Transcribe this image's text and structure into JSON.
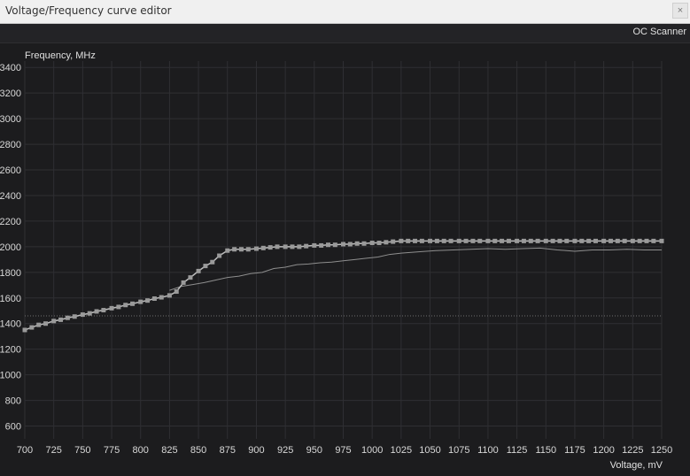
{
  "window": {
    "title": "Voltage/Frequency curve editor",
    "close_label": "×"
  },
  "toolbar": {
    "oc_scanner_label": "OC Scanner"
  },
  "colors": {
    "background": "#1c1c1e",
    "grid": "#2f2f33",
    "curve": "#bdbdbd",
    "point": "#9a9a9a",
    "reference_line": "#6e6e6e",
    "ref_curve": "#8e8e8e"
  },
  "chart_data": {
    "type": "line",
    "xlabel": "Voltage, mV",
    "ylabel": "Frequency, MHz",
    "xlim": [
      700,
      1250
    ],
    "ylim": [
      500,
      3450
    ],
    "x_ticks": [
      700,
      725,
      750,
      775,
      800,
      825,
      850,
      875,
      900,
      925,
      950,
      975,
      1000,
      1025,
      1050,
      1075,
      1100,
      1125,
      1150,
      1175,
      1200,
      1225,
      1250
    ],
    "y_ticks": [
      600,
      800,
      1000,
      1200,
      1400,
      1600,
      1800,
      2000,
      2200,
      2400,
      2600,
      2800,
      3000,
      3200,
      3400
    ],
    "grid": true,
    "reference_line_y": 1460,
    "series": [
      {
        "role": "editable curve",
        "x": [
          700,
          706,
          712,
          718,
          725,
          731,
          737,
          743,
          750,
          756,
          762,
          768,
          775,
          781,
          787,
          793,
          800,
          806,
          812,
          818,
          825,
          831,
          837,
          843,
          850,
          856,
          862,
          868,
          875,
          881,
          887,
          893,
          900,
          906,
          912,
          918,
          925,
          931,
          937,
          943,
          950,
          956,
          962,
          968,
          975,
          981,
          987,
          993,
          1000,
          1006,
          1012,
          1018,
          1025,
          1031,
          1037,
          1043,
          1050,
          1056,
          1062,
          1068,
          1075,
          1081,
          1087,
          1093,
          1100,
          1106,
          1112,
          1118,
          1125,
          1131,
          1137,
          1143,
          1150,
          1156,
          1162,
          1168,
          1175,
          1181,
          1187,
          1193,
          1200,
          1206,
          1212,
          1218,
          1225,
          1231,
          1237,
          1243,
          1250
        ],
        "y": [
          1350,
          1370,
          1390,
          1400,
          1420,
          1430,
          1445,
          1455,
          1470,
          1480,
          1495,
          1505,
          1520,
          1530,
          1545,
          1555,
          1570,
          1580,
          1595,
          1605,
          1620,
          1650,
          1720,
          1760,
          1810,
          1850,
          1880,
          1930,
          1970,
          1980,
          1980,
          1980,
          1985,
          1990,
          1995,
          2000,
          2000,
          2000,
          2000,
          2005,
          2010,
          2010,
          2015,
          2015,
          2020,
          2020,
          2025,
          2025,
          2030,
          2030,
          2035,
          2040,
          2045,
          2045,
          2045,
          2045,
          2045,
          2045,
          2045,
          2045,
          2045,
          2045,
          2045,
          2045,
          2045,
          2045,
          2045,
          2045,
          2045,
          2045,
          2045,
          2045,
          2045,
          2045,
          2045,
          2045,
          2045,
          2045,
          2045,
          2045,
          2045,
          2045,
          2045,
          2045,
          2045,
          2045,
          2045,
          2045,
          2045
        ]
      },
      {
        "role": "reference curve",
        "x": [
          825,
          835,
          845,
          855,
          865,
          875,
          885,
          895,
          905,
          915,
          925,
          935,
          945,
          955,
          965,
          975,
          985,
          995,
          1005,
          1015,
          1025,
          1040,
          1055,
          1070,
          1085,
          1100,
          1115,
          1130,
          1145,
          1160,
          1175,
          1190,
          1205,
          1220,
          1235,
          1250
        ],
        "y": [
          1660,
          1690,
          1705,
          1720,
          1740,
          1760,
          1770,
          1790,
          1800,
          1830,
          1840,
          1860,
          1865,
          1875,
          1880,
          1890,
          1900,
          1910,
          1920,
          1940,
          1950,
          1960,
          1970,
          1975,
          1980,
          1985,
          1980,
          1985,
          1990,
          1975,
          1965,
          1975,
          1975,
          1980,
          1975,
          1975
        ]
      }
    ]
  }
}
